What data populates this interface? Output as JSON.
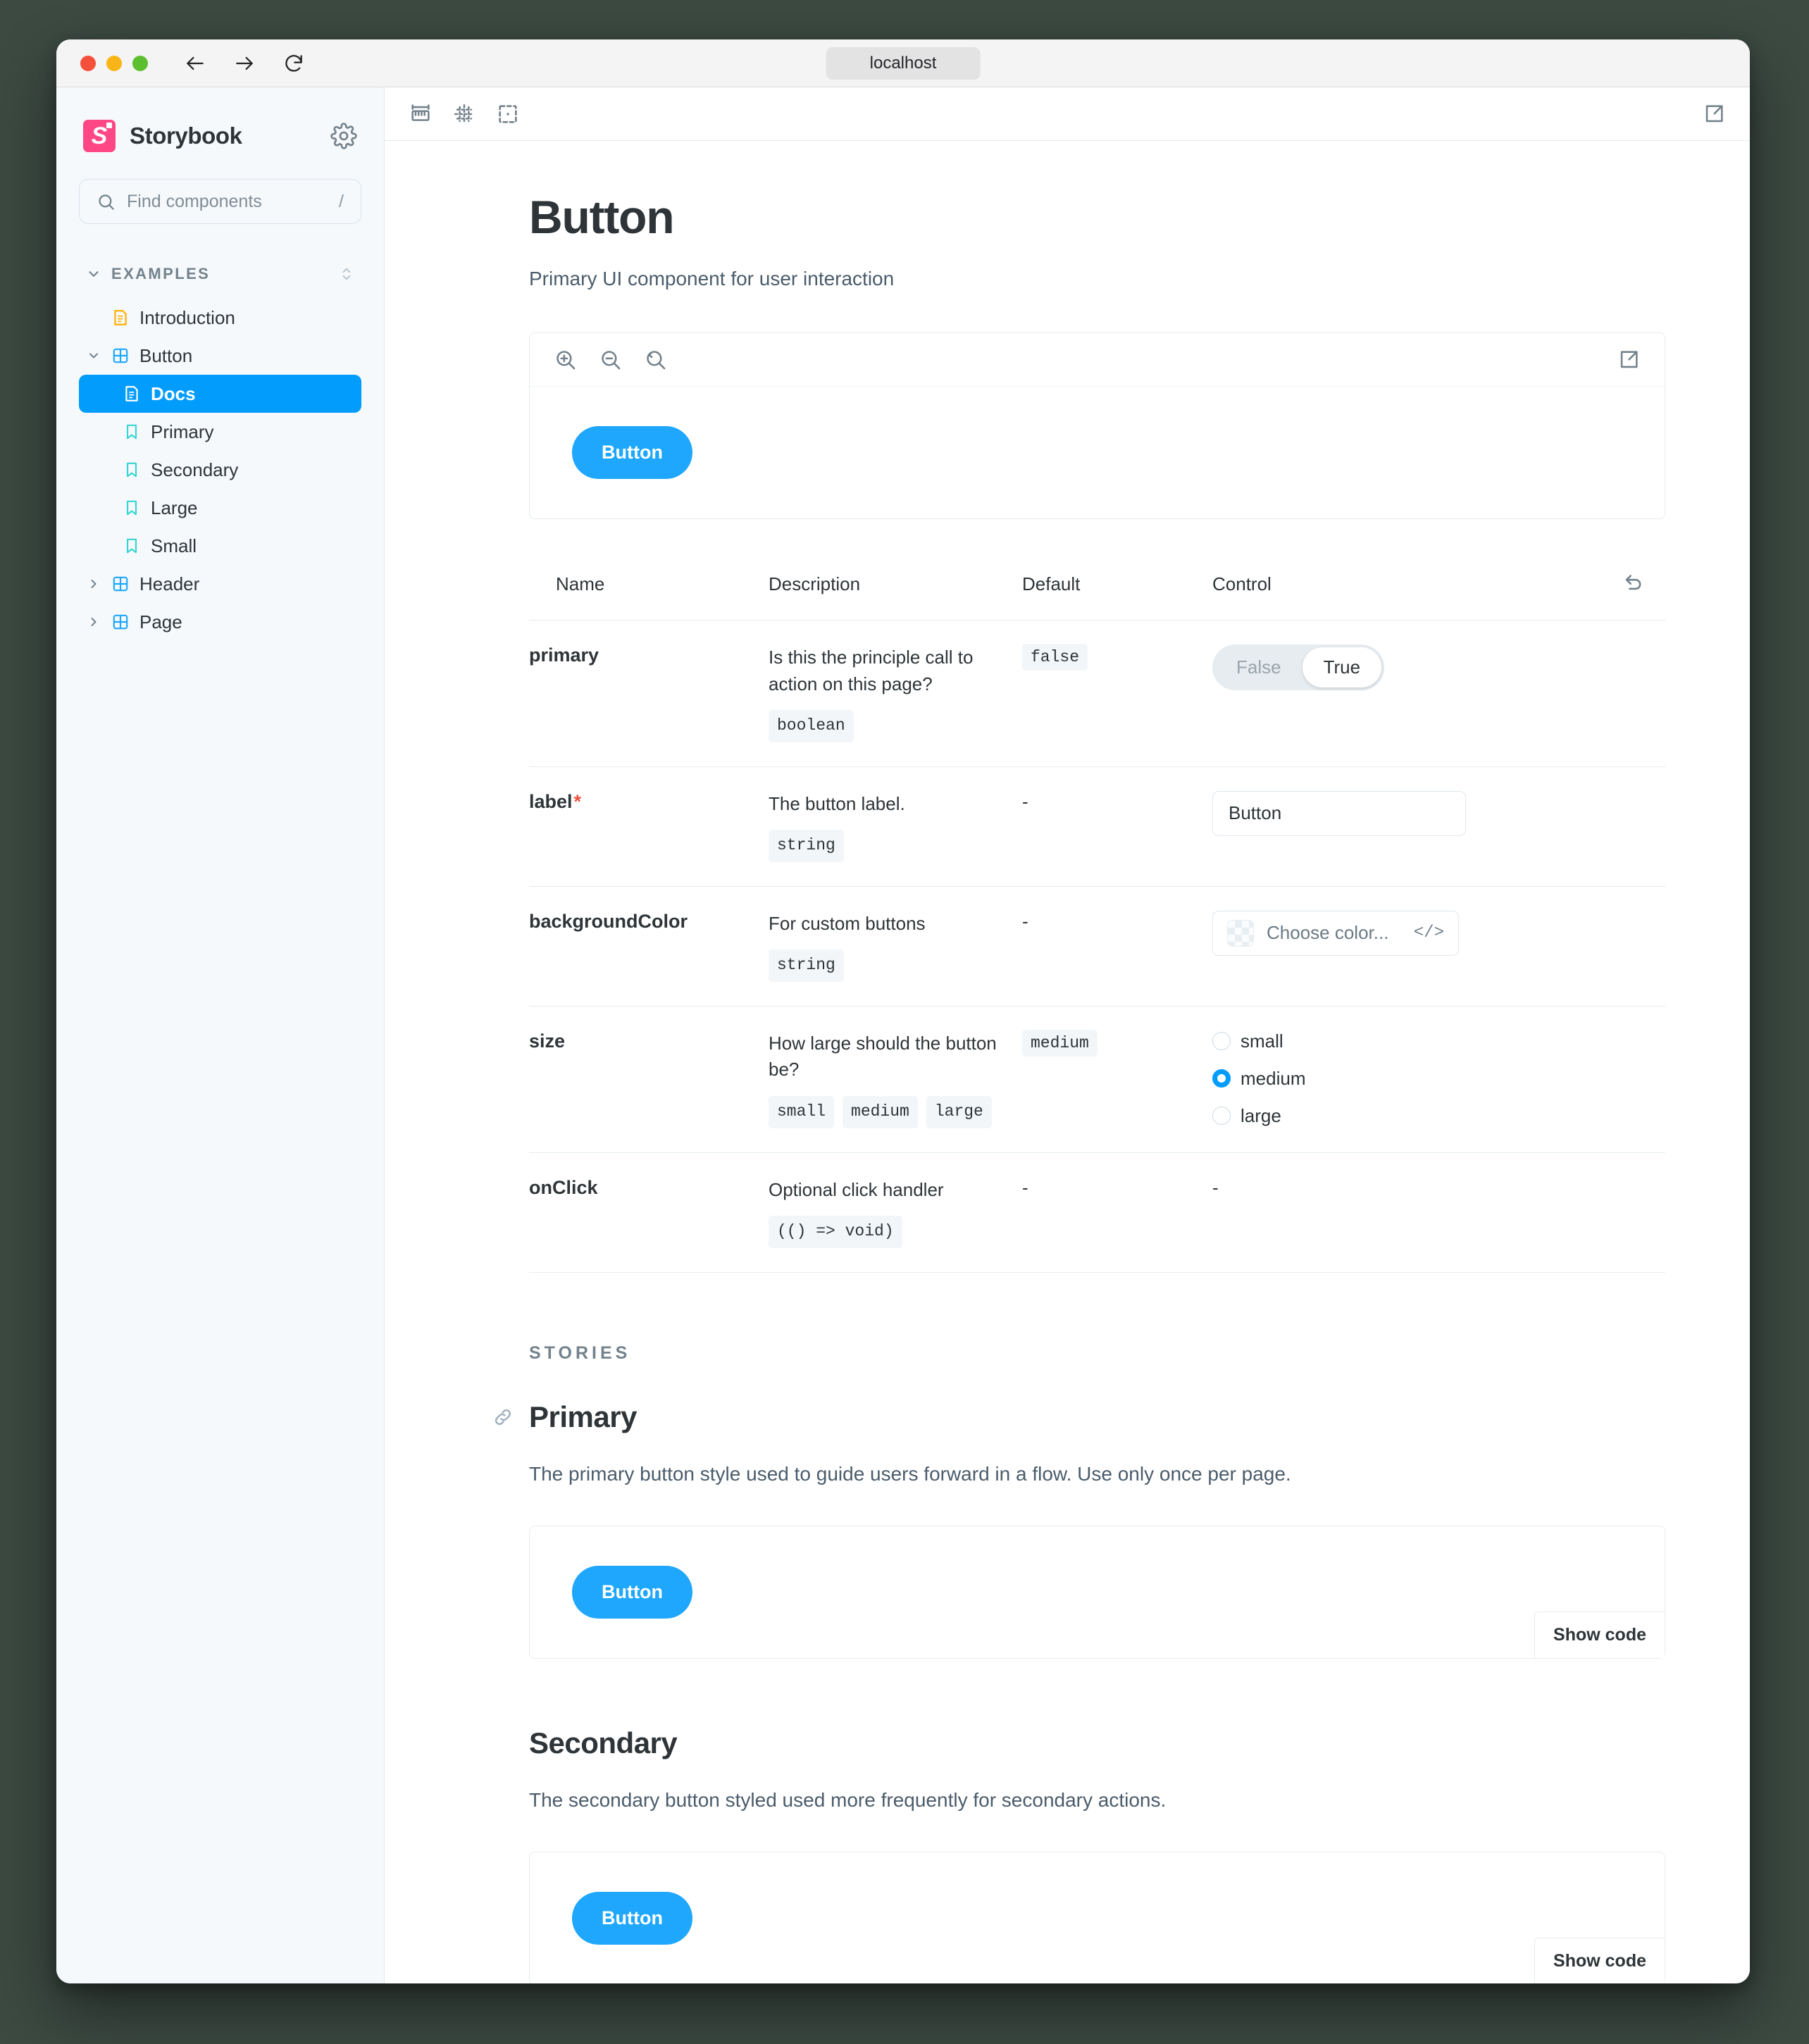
{
  "browser": {
    "url": "localhost",
    "back_label": "Back",
    "forward_label": "Forward",
    "reload_label": "Reload"
  },
  "sidebar": {
    "brand": "Storybook",
    "settings_label": "Settings",
    "search": {
      "placeholder": "Find components",
      "shortcut": "/"
    },
    "section": {
      "title": "EXAMPLES",
      "expand_label": "Expand all"
    },
    "items": [
      {
        "label": "Introduction",
        "icon": "document-icon",
        "level": 2,
        "selected": false,
        "expandable": false
      },
      {
        "label": "Button",
        "icon": "component-icon",
        "level": 1,
        "selected": false,
        "expandable": true,
        "expanded": true
      },
      {
        "label": "Docs",
        "icon": "document-icon",
        "level": 3,
        "selected": true,
        "expandable": false
      },
      {
        "label": "Primary",
        "icon": "story-icon",
        "level": 3,
        "selected": false,
        "expandable": false
      },
      {
        "label": "Secondary",
        "icon": "story-icon",
        "level": 3,
        "selected": false,
        "expandable": false
      },
      {
        "label": "Large",
        "icon": "story-icon",
        "level": 3,
        "selected": false,
        "expandable": false
      },
      {
        "label": "Small",
        "icon": "story-icon",
        "level": 3,
        "selected": false,
        "expandable": false
      },
      {
        "label": "Header",
        "icon": "component-icon",
        "level": 1,
        "selected": false,
        "expandable": true,
        "expanded": false
      },
      {
        "label": "Page",
        "icon": "component-icon",
        "level": 1,
        "selected": false,
        "expandable": true,
        "expanded": false
      }
    ]
  },
  "toolbar": {
    "measure_label": "Measure",
    "grid_label": "Grid",
    "outline_label": "Outline",
    "open_new_tab_label": "Open canvas in new tab"
  },
  "page": {
    "title": "Button",
    "subtitle": "Primary UI component for user interaction"
  },
  "preview": {
    "zoom_in_label": "Zoom in",
    "zoom_out_label": "Zoom out",
    "zoom_reset_label": "Reset zoom",
    "open_label": "Open in new tab",
    "button_label": "Button"
  },
  "args_table": {
    "headers": [
      "Name",
      "Description",
      "Default",
      "Control"
    ],
    "reset_label": "Reset controls",
    "rows": [
      {
        "name": "primary",
        "required": false,
        "description": "Is this the principle call to action on this page?",
        "types": [
          "boolean"
        ],
        "default": "false",
        "default_is_code": true,
        "control": {
          "kind": "boolean",
          "options": [
            "False",
            "True"
          ],
          "value": "True"
        }
      },
      {
        "name": "label",
        "required": true,
        "description": "The button label.",
        "types": [
          "string"
        ],
        "default": "-",
        "default_is_code": false,
        "control": {
          "kind": "text",
          "value": "Button"
        }
      },
      {
        "name": "backgroundColor",
        "required": false,
        "description": "For custom buttons",
        "types": [
          "string"
        ],
        "default": "-",
        "default_is_code": false,
        "control": {
          "kind": "color",
          "placeholder": "Choose color...",
          "code_toggle": "</>"
        }
      },
      {
        "name": "size",
        "required": false,
        "description": "How large should the button be?",
        "types": [
          "small",
          "medium",
          "large"
        ],
        "default": "medium",
        "default_is_code": true,
        "control": {
          "kind": "radio",
          "options": [
            "small",
            "medium",
            "large"
          ],
          "value": "medium"
        }
      },
      {
        "name": "onClick",
        "required": false,
        "description": "Optional click handler",
        "types": [
          "(() => void)"
        ],
        "default": "-",
        "default_is_code": false,
        "control": {
          "kind": "none",
          "value": "-"
        }
      }
    ]
  },
  "stories": {
    "label": "STORIES",
    "show_code_label": "Show code",
    "items": [
      {
        "title": "Primary",
        "description": "The primary button style used to guide users forward in a flow. Use only once per page.",
        "button_label": "Button",
        "has_anchor": true
      },
      {
        "title": "Secondary",
        "description": "The secondary button styled used more frequently for secondary actions.",
        "button_label": "Button",
        "has_anchor": false
      }
    ]
  },
  "colors": {
    "brand_pink": "#ff4785",
    "accent_blue": "#1ea7fd",
    "selected_blue": "#029cfd",
    "story_teal": "#37d5d3",
    "doc_orange": "#ffae00",
    "required_red": "#f24f3f"
  }
}
